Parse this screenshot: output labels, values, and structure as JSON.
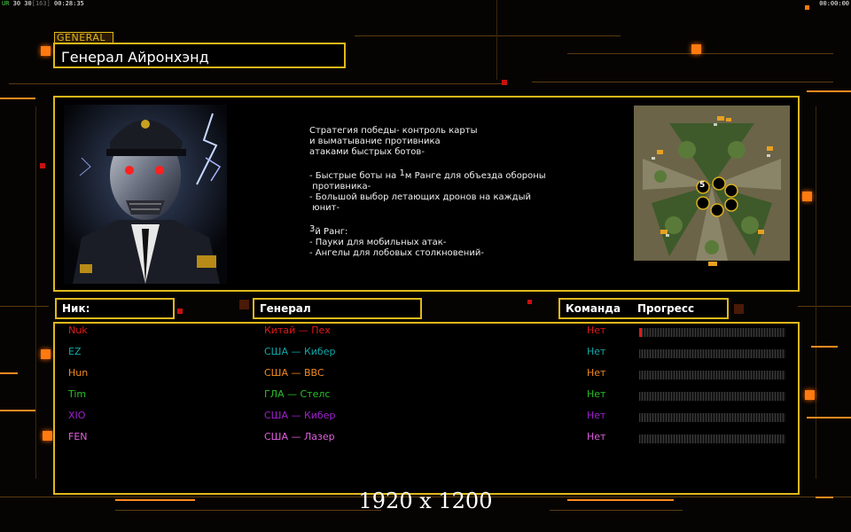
{
  "topbar": {
    "ur_label": "UR",
    "stats": "30 30",
    "bracket": "[163]",
    "time_left": "00:28:35",
    "time_right": "00:00:00"
  },
  "general": {
    "tag": "GENERAL",
    "name": "Генерал Айронхэнд"
  },
  "description": {
    "line1": "Стратегия победы- контроль карты",
    "line2": "и выматывание противника",
    "line3": "атаками быстрых ботов-",
    "line4_pre": "- Быстрые боты на ",
    "line4_sup": "1",
    "line4_post": "м Ранге для объезда обороны",
    "line5": " противника-",
    "line6": "- Большой выбор летающих дронов на каждый",
    "line7": " юнит-",
    "rank_sup": "3",
    "rank_post": "й Ранг:",
    "line9": "- Пауки для мобильных атак-",
    "line10": "- Ангелы для лобовых столкновений-"
  },
  "minimap": {
    "center_label": "5"
  },
  "headers": {
    "nick": "Ник:",
    "general": "Генерал",
    "team": "Команда",
    "progress": "Прогресс"
  },
  "players": [
    {
      "nick": "Nuk",
      "general": "Китай — Пех",
      "team": "Нет",
      "color": "#e01818",
      "progress": 0.01
    },
    {
      "nick": "EZ",
      "general": "США — Кибер",
      "team": "Нет",
      "color": "#10a8a8",
      "progress": 0
    },
    {
      "nick": "Hun",
      "general": "США — ВВС",
      "team": "Нет",
      "color": "#f08a20",
      "progress": 0
    },
    {
      "nick": "Tim",
      "general": "ГЛА — Стелс",
      "team": "Нет",
      "color": "#28c028",
      "progress": 0
    },
    {
      "nick": "XIO",
      "general": "США — Кибер",
      "team": "Нет",
      "color": "#a020d0",
      "progress": 0
    },
    {
      "nick": "FEN",
      "general": "США — Лазер",
      "team": "Нет",
      "color": "#e060e0",
      "progress": 0
    }
  ],
  "resolution": "1920 x 1200",
  "colors": {
    "accent": "#e0b81a",
    "orange": "#ff7a10"
  }
}
